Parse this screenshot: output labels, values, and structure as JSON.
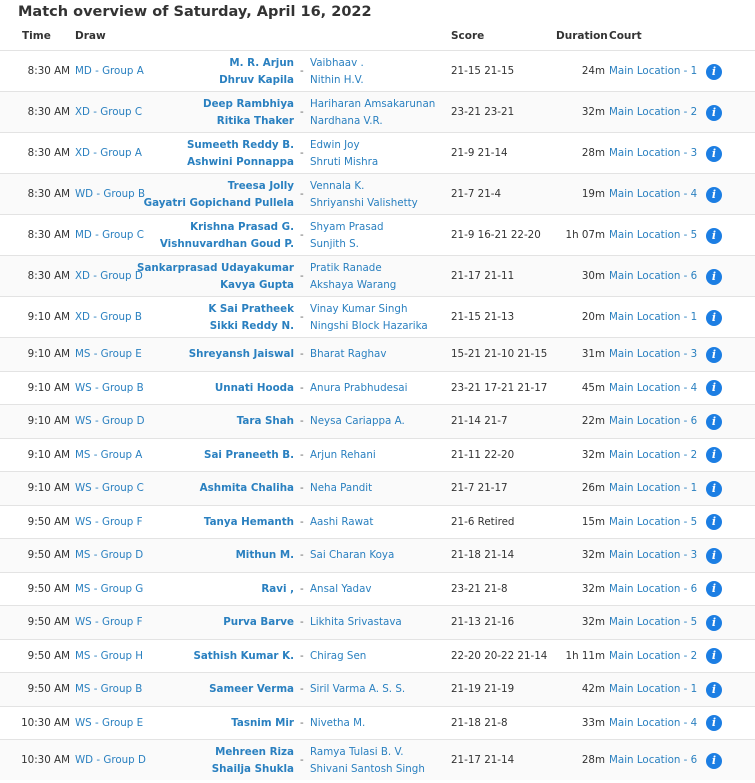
{
  "title": "Match overview of Saturday, April 16, 2022",
  "headers": {
    "time": "Time",
    "draw": "Draw",
    "score": "Score",
    "duration": "Duration",
    "court": "Court"
  },
  "info_glyph": "i",
  "rows": [
    {
      "time": "8:30 AM",
      "draw": "MD - Group A",
      "team1": [
        "M. R. Arjun",
        "Dhruv Kapila"
      ],
      "team2": [
        "Vaibhaav .",
        "Nithin H.V."
      ],
      "score": "21-15 21-15",
      "duration": "24m",
      "court": "Main Location - 1"
    },
    {
      "time": "8:30 AM",
      "draw": "XD - Group C",
      "team1": [
        "Deep Rambhiya",
        "Ritika Thaker"
      ],
      "team2": [
        "Hariharan Amsakarunan",
        "Nardhana V.R."
      ],
      "score": "23-21 23-21",
      "duration": "32m",
      "court": "Main Location - 2"
    },
    {
      "time": "8:30 AM",
      "draw": "XD - Group A",
      "team1": [
        "Sumeeth Reddy B.",
        "Ashwini Ponnappa"
      ],
      "team2": [
        "Edwin Joy",
        "Shruti Mishra"
      ],
      "score": "21-9 21-14",
      "duration": "28m",
      "court": "Main Location - 3"
    },
    {
      "time": "8:30 AM",
      "draw": "WD - Group B",
      "team1": [
        "Treesa Jolly",
        "Gayatri Gopichand Pullela"
      ],
      "team2": [
        "Vennala K.",
        "Shriyanshi Valishetty"
      ],
      "score": "21-7 21-4",
      "duration": "19m",
      "court": "Main Location - 4"
    },
    {
      "time": "8:30 AM",
      "draw": "MD - Group C",
      "team1": [
        "Krishna Prasad G.",
        "Vishnuvardhan Goud P."
      ],
      "team2": [
        "Shyam Prasad",
        "Sunjith S."
      ],
      "score": "21-9 16-21 22-20",
      "duration": "1h 07m",
      "court": "Main Location - 5"
    },
    {
      "time": "8:30 AM",
      "draw": "XD - Group D",
      "team1": [
        "Sankarprasad Udayakumar",
        "Kavya Gupta"
      ],
      "team2": [
        "Pratik Ranade",
        "Akshaya Warang"
      ],
      "score": "21-17 21-11",
      "duration": "30m",
      "court": "Main Location - 6"
    },
    {
      "time": "9:10 AM",
      "draw": "XD - Group B",
      "team1": [
        "K Sai Pratheek",
        "Sikki Reddy N."
      ],
      "team2": [
        "Vinay Kumar Singh",
        "Ningshi Block Hazarika"
      ],
      "score": "21-15 21-13",
      "duration": "20m",
      "court": "Main Location - 1"
    },
    {
      "time": "9:10 AM",
      "draw": "MS - Group E",
      "team1": [
        "Shreyansh Jaiswal"
      ],
      "team2": [
        "Bharat Raghav"
      ],
      "score": "15-21 21-10 21-15",
      "duration": "31m",
      "court": "Main Location - 3"
    },
    {
      "time": "9:10 AM",
      "draw": "WS - Group B",
      "team1": [
        "Unnati Hooda"
      ],
      "team2": [
        "Anura Prabhudesai"
      ],
      "score": "23-21 17-21 21-17",
      "duration": "45m",
      "court": "Main Location - 4"
    },
    {
      "time": "9:10 AM",
      "draw": "WS - Group D",
      "team1": [
        "Tara Shah"
      ],
      "team2": [
        "Neysa Cariappa A."
      ],
      "score": "21-14 21-7",
      "duration": "22m",
      "court": "Main Location - 6"
    },
    {
      "time": "9:10 AM",
      "draw": "MS - Group A",
      "team1": [
        "Sai Praneeth B."
      ],
      "team2": [
        "Arjun Rehani"
      ],
      "score": "21-11 22-20",
      "duration": "32m",
      "court": "Main Location - 2"
    },
    {
      "time": "9:10 AM",
      "draw": "WS - Group C",
      "team1": [
        "Ashmita Chaliha"
      ],
      "team2": [
        "Neha Pandit"
      ],
      "score": "21-7 21-17",
      "duration": "26m",
      "court": "Main Location - 1"
    },
    {
      "time": "9:50 AM",
      "draw": "WS - Group F",
      "team1": [
        "Tanya Hemanth"
      ],
      "team2": [
        "Aashi Rawat"
      ],
      "score": "21-6 Retired",
      "duration": "15m",
      "court": "Main Location - 5"
    },
    {
      "time": "9:50 AM",
      "draw": "MS - Group D",
      "team1": [
        "Mithun M."
      ],
      "team2": [
        "Sai Charan Koya"
      ],
      "score": "21-18 21-14",
      "duration": "32m",
      "court": "Main Location - 3"
    },
    {
      "time": "9:50 AM",
      "draw": "MS - Group G",
      "team1": [
        "Ravi ,"
      ],
      "team2": [
        "Ansal Yadav"
      ],
      "score": "23-21 21-8",
      "duration": "32m",
      "court": "Main Location - 6"
    },
    {
      "time": "9:50 AM",
      "draw": "WS - Group F",
      "team1": [
        "Purva Barve"
      ],
      "team2": [
        "Likhita Srivastava"
      ],
      "score": "21-13 21-16",
      "duration": "32m",
      "court": "Main Location - 5"
    },
    {
      "time": "9:50 AM",
      "draw": "MS - Group H",
      "team1": [
        "Sathish Kumar K."
      ],
      "team2": [
        "Chirag Sen"
      ],
      "score": "22-20 20-22 21-14",
      "duration": "1h 11m",
      "court": "Main Location - 2"
    },
    {
      "time": "9:50 AM",
      "draw": "MS - Group B",
      "team1": [
        "Sameer Verma"
      ],
      "team2": [
        "Siril Varma A. S. S."
      ],
      "score": "21-19 21-19",
      "duration": "42m",
      "court": "Main Location - 1"
    },
    {
      "time": "10:30 AM",
      "draw": "WS - Group E",
      "team1": [
        "Tasnim Mir"
      ],
      "team2": [
        "Nivetha M."
      ],
      "score": "21-18 21-8",
      "duration": "33m",
      "court": "Main Location - 4"
    },
    {
      "time": "10:30 AM",
      "draw": "WD - Group D",
      "team1": [
        "Mehreen Riza",
        "Shailja Shukla"
      ],
      "team2": [
        "Ramya Tulasi B. V.",
        "Shivani Santosh Singh"
      ],
      "score": "21-17 21-14",
      "duration": "28m",
      "court": "Main Location - 6"
    }
  ]
}
